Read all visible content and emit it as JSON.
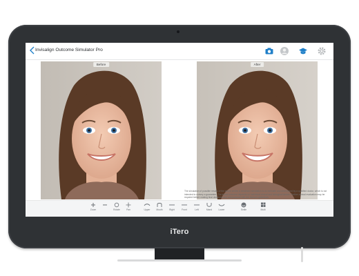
{
  "app": {
    "title": "Invisalign Outcome Simulator Pro"
  },
  "device": {
    "brand": "iTero"
  },
  "panels": {
    "before_label": "Before",
    "after_label": "After"
  },
  "disclaimer": "The simulation of possible results of the above smiles & treatment simulation is an estimate and determined by a qualified doctor, which is not intended to convey a guarantee. The actual outcome depends on individual clinical and biological factors. Further clinical evaluation may be required before making final decisions and comparisons with the doctor's guidelines.",
  "toolbar": {
    "items": [
      {
        "icon": "plus-icon",
        "label": "Zoom"
      },
      {
        "icon": "minus-icon",
        "label": ""
      },
      {
        "icon": "circle-icon",
        "label": "Rotate"
      },
      {
        "icon": "move-icon",
        "label": "Pan"
      },
      {
        "icon": "upper-jaw-icon",
        "label": "Upper"
      },
      {
        "icon": "mouth-icon",
        "label": "Mouth"
      },
      {
        "icon": "right-view-icon",
        "label": "Right"
      },
      {
        "icon": "front-view-icon",
        "label": "Front"
      },
      {
        "icon": "left-view-icon",
        "label": "Left"
      },
      {
        "icon": "mandible-icon",
        "label": "Mand"
      },
      {
        "icon": "lower-jaw-icon",
        "label": "Lower"
      },
      {
        "icon": "smile-icon",
        "label": "Smile"
      },
      {
        "icon": "grid-icon",
        "label": "Multi"
      }
    ]
  },
  "colors": {
    "accent": "#1f7fc8",
    "bezel": "#2f3235"
  }
}
